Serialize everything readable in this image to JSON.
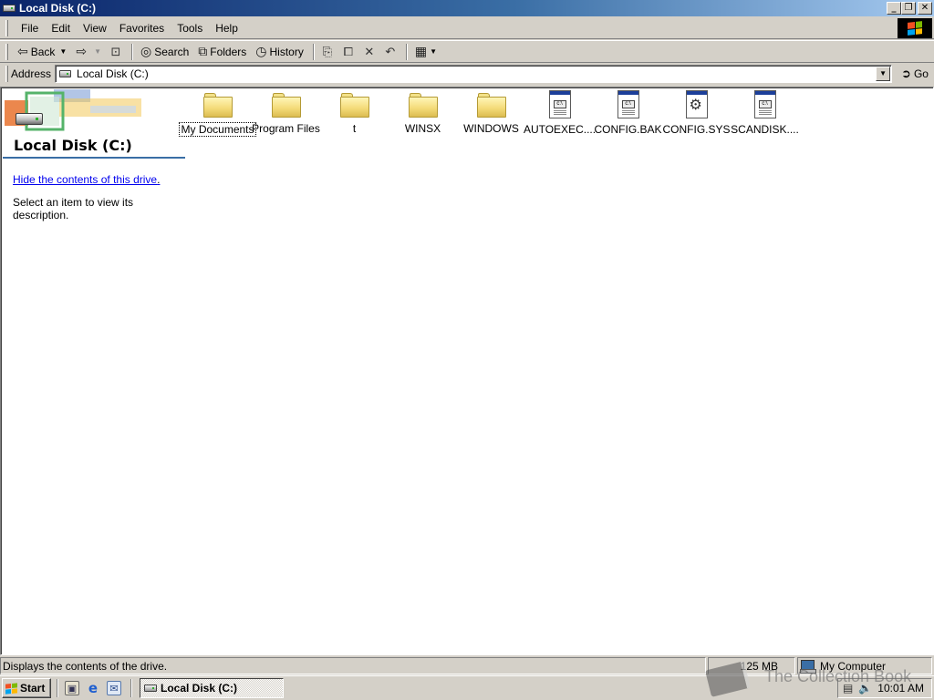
{
  "window": {
    "title": "Local Disk (C:)",
    "controls": {
      "minimize": "_",
      "maximize": "❐",
      "close": "✕"
    }
  },
  "menubar": {
    "items": [
      "File",
      "Edit",
      "View",
      "Favorites",
      "Tools",
      "Help"
    ]
  },
  "toolbar": {
    "back_label": "Back",
    "search_label": "Search",
    "folders_label": "Folders",
    "history_label": "History",
    "icons": [
      "back-arrow-icon",
      "forward-arrow-icon",
      "up-folder-icon",
      "search-icon",
      "folders-icon",
      "history-icon",
      "move-to-icon",
      "copy-to-icon",
      "delete-icon",
      "undo-icon",
      "views-icon"
    ]
  },
  "address": {
    "label": "Address",
    "value": "Local Disk (C:)",
    "go_label": "Go"
  },
  "left_panel": {
    "title": "Local Disk (C:)",
    "link_text": "Hide the contents of this drive",
    "link_suffix": ".",
    "description": "Select an item to view its description."
  },
  "files": [
    {
      "name": "My Documents",
      "type": "folder"
    },
    {
      "name": "Program Files",
      "type": "folder"
    },
    {
      "name": "t",
      "type": "folder"
    },
    {
      "name": "WINSX",
      "type": "folder"
    },
    {
      "name": "WINDOWS",
      "type": "folder"
    },
    {
      "name": "AUTOEXEC....",
      "type": "document"
    },
    {
      "name": "CONFIG.BAK",
      "type": "document"
    },
    {
      "name": "CONFIG.SYS",
      "type": "system-file"
    },
    {
      "name": "SCANDISK....",
      "type": "document"
    }
  ],
  "statusbar": {
    "message": "Displays the contents of the drive.",
    "size": "125 MB",
    "zone": "My Computer"
  },
  "taskbar": {
    "start_label": "Start",
    "task_label": "Local Disk (C:)",
    "clock": "10:01 AM"
  },
  "watermark": {
    "text": "The Collection Book"
  },
  "colors": {
    "title_start": "#0a246a",
    "title_end": "#a6caf0",
    "face": "#d4d0c8",
    "link": "#0000ee",
    "panel_rule": "#3a6ea5"
  }
}
